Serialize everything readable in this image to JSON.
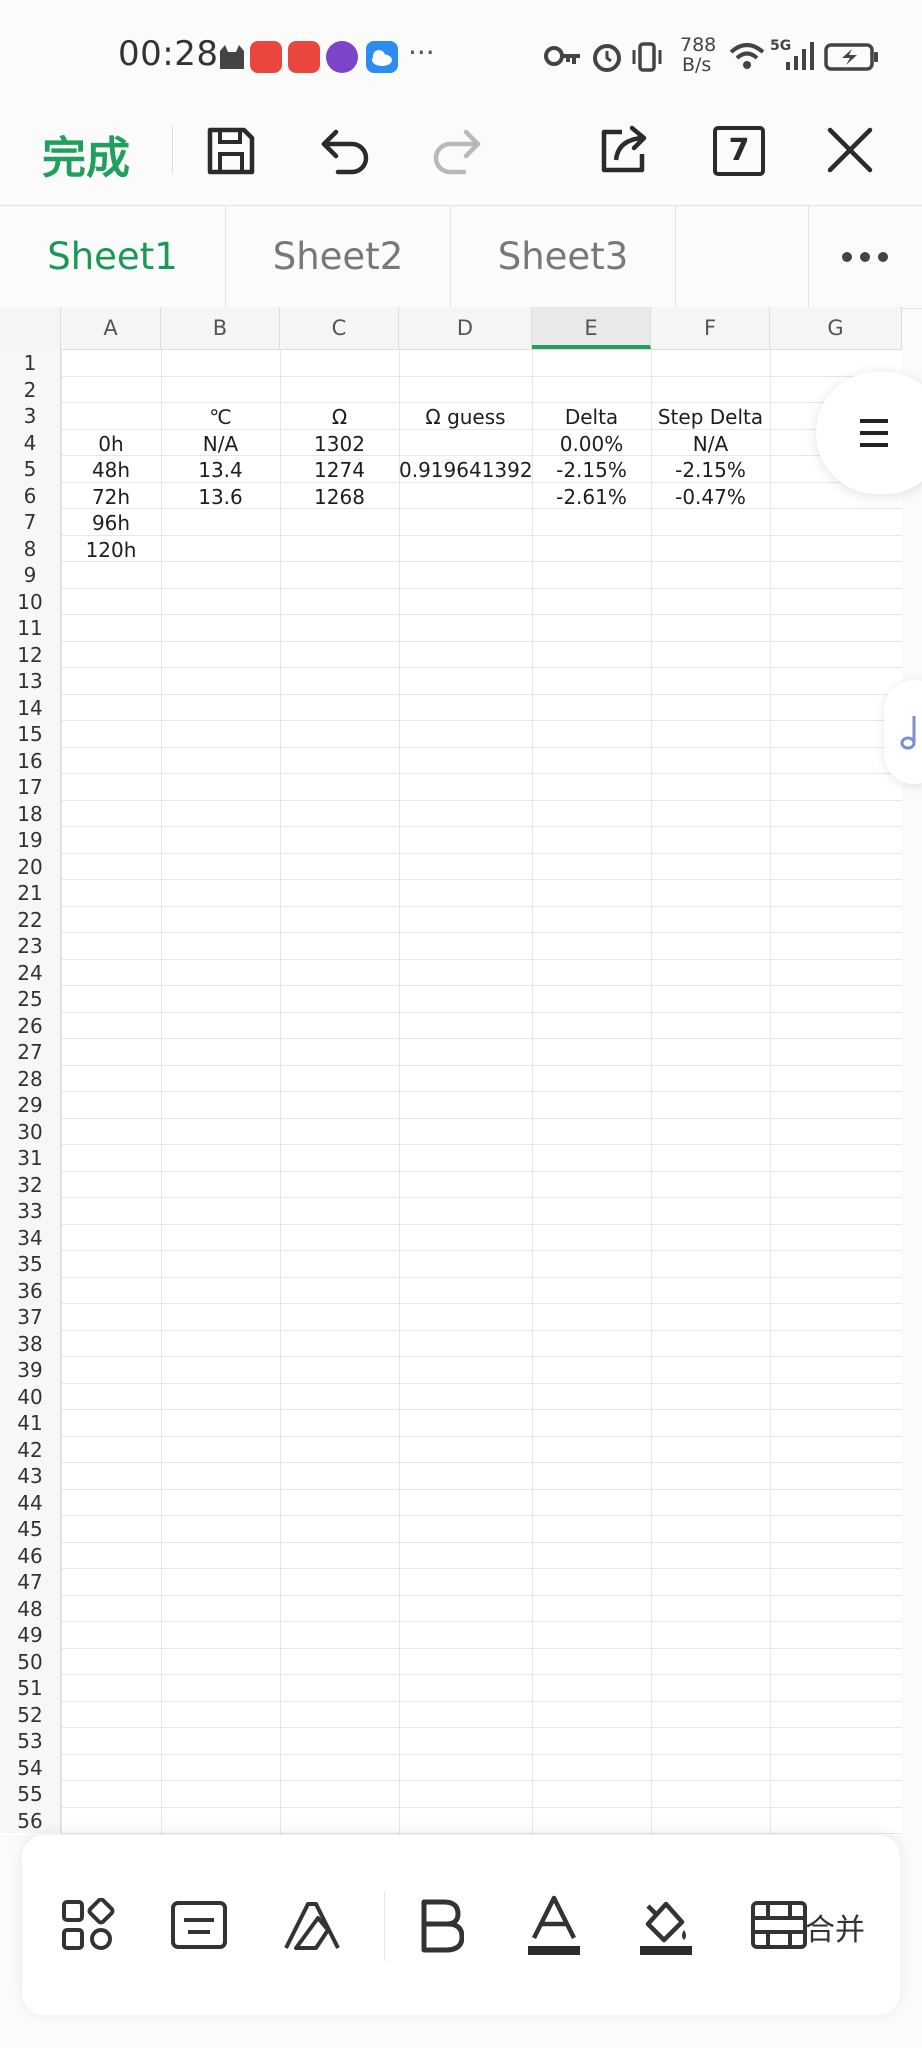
{
  "status_bar": {
    "time": "00:28",
    "more_dots": "···",
    "network_speed_value": "788",
    "network_speed_unit": "B/s",
    "signal_label": "5G"
  },
  "toolbar": {
    "done_label": "完成",
    "tab_count": "7"
  },
  "sheet_tabs": [
    "Sheet1",
    "Sheet2",
    "Sheet3"
  ],
  "active_sheet": "Sheet1",
  "grid": {
    "columns": [
      "A",
      "B",
      "C",
      "D",
      "E",
      "F",
      "G"
    ],
    "selected_column": "E",
    "row_count": 56,
    "cells": {
      "B3": "℃",
      "C3": "Ω",
      "D3": "Ω guess",
      "E3": "Delta",
      "F3": "Step Delta",
      "A4": "0h",
      "B4": "N/A",
      "C4": "1302",
      "E4": "0.00%",
      "F4": "N/A",
      "A5": "48h",
      "B5": "13.4",
      "C5": "1274",
      "D5": "0.919641392",
      "E5": "-2.15%",
      "F5": "-2.15%",
      "A6": "72h",
      "B6": "13.6",
      "C6": "1268",
      "E6": "-2.61%",
      "F6": "-0.47%",
      "A7": "96h",
      "A8": "120h"
    }
  },
  "bottom_toolbar": {
    "merge_label": "合并",
    "icons": [
      "apps-icon",
      "keyboard-icon",
      "clear-format-icon",
      "bold-icon",
      "font-color-icon",
      "fill-color-icon",
      "merge-cells-icon"
    ]
  },
  "colors": {
    "accent": "#1fa05c",
    "active_tab": "#1a9856"
  }
}
